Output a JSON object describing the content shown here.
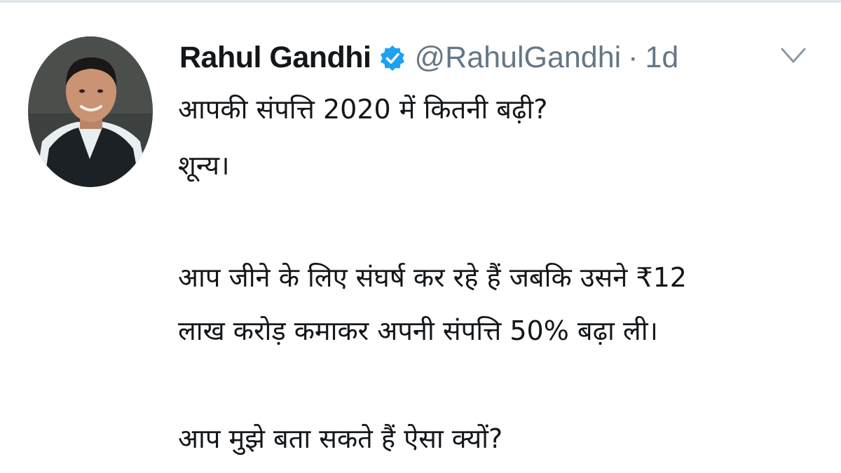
{
  "tweet": {
    "author": {
      "display_name": "Rahul Gandhi",
      "handle": "@RahulGandhi",
      "separator": "·",
      "timestamp": "1d",
      "verified": true,
      "avatar_icon": "profile-photo"
    },
    "menu_icon": "chevron-down-icon",
    "lines": [
      "आपकी संपत्ति 2020 में कितनी बढ़ी?",
      "शून्य।",
      "आप जीने के लिए संघर्ष कर रहे हैं जबकि उसने ₹12",
      "लाख करोड़ कमाकर अपनी संपत्ति 50% बढ़ा ली।",
      "आप मुझे बता सकते हैं ऐसा क्यों?"
    ]
  },
  "colors": {
    "name": "#14171a",
    "secondary_text": "#657786",
    "verified_badge": "#1da1f2",
    "divider": "#dfe7ea",
    "background": "#ffffff"
  }
}
